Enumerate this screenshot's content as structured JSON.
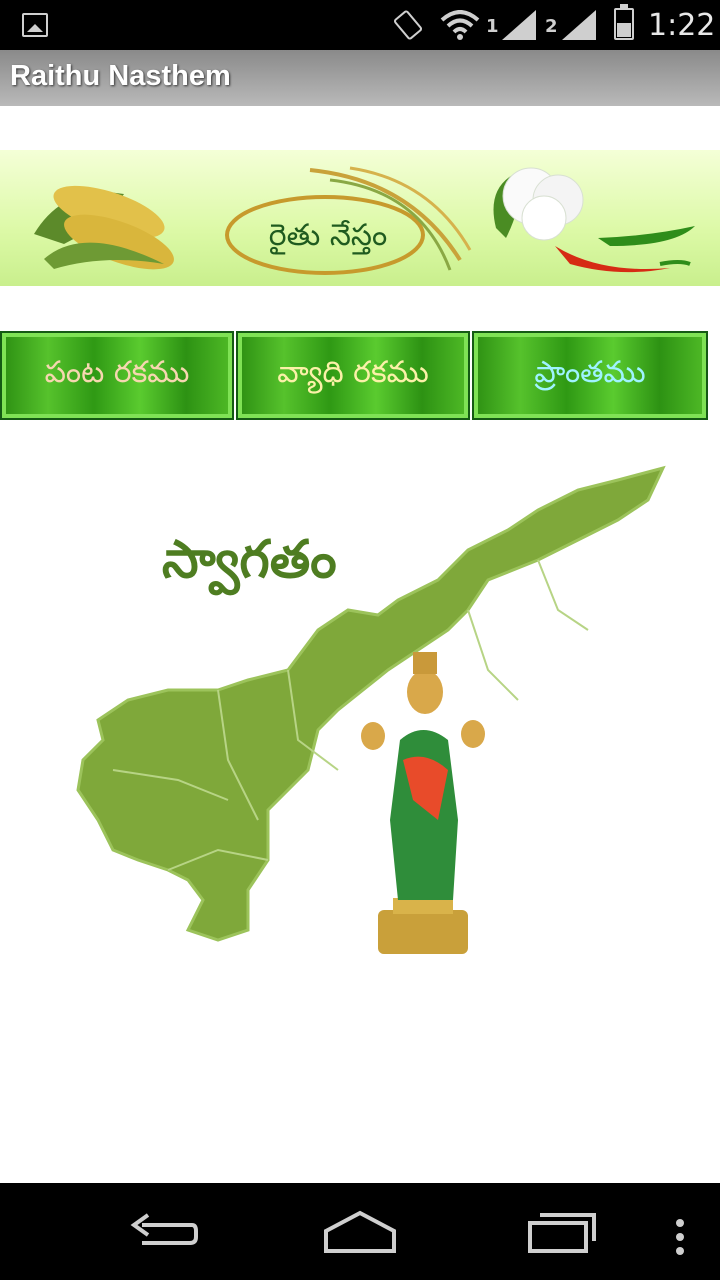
{
  "status_bar": {
    "sim1": "1",
    "sim2": "2",
    "time": "1:22"
  },
  "app": {
    "title": "Raithu Nasthem"
  },
  "banner": {
    "title": "రైతు నేస్తం"
  },
  "tabs": [
    {
      "label": "పంట రకము"
    },
    {
      "label": "వ్యాధి రకము"
    },
    {
      "label": "ప్రాంతము"
    }
  ],
  "map": {
    "welcome": "స్వాగతం"
  },
  "colors": {
    "map_green": "#7fa83a",
    "banner_green": "#dcf9a6",
    "button_green": "#3aa317"
  },
  "icons": {
    "status": [
      "gallery-icon",
      "rotate-icon",
      "wifi-icon",
      "signal-icon",
      "battery-icon"
    ],
    "nav": [
      "back-icon",
      "home-icon",
      "recent-apps-icon",
      "overflow-menu-icon"
    ]
  }
}
